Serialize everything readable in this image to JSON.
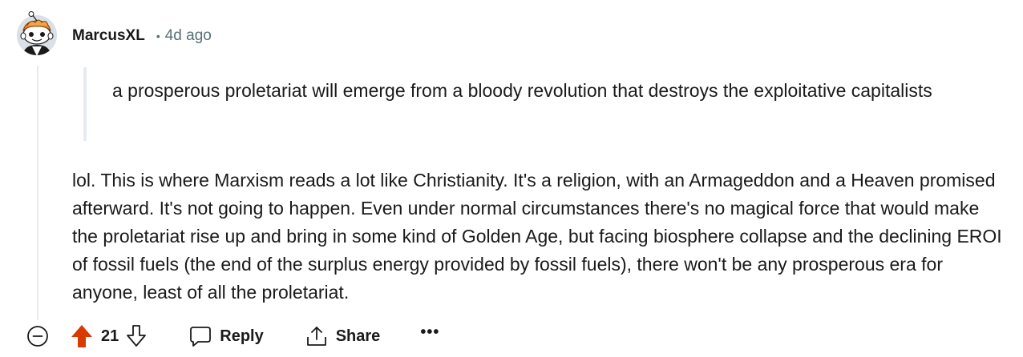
{
  "comment": {
    "author": "MarcusXL",
    "separator": "•",
    "timestamp": "4d ago",
    "quote": "a prosperous proletariat will emerge from a bloody revolution that destroys the exploitative capitalists",
    "body": "lol. This is where Marxism reads a lot like Christianity. It's a religion, with an Armageddon and a Heaven promised afterward. It's not going to happen. Even under normal circumstances there's no magical force that would make the proletariat rise up and bring in some kind of Golden Age, but facing biosphere collapse and the declining EROI of fossil fuels (the end of the surplus energy provided by fossil fuels), there won't be any prosperous era for anyone, least of all the proletariat."
  },
  "actions": {
    "score": "21",
    "reply_label": "Reply",
    "share_label": "Share",
    "more_label": "•••"
  },
  "colors": {
    "upvote_active": "#d93a00",
    "meta_text": "#576f76",
    "thread_line": "#e5ebee"
  },
  "icons": {
    "collapse": "minus-circle-icon",
    "upvote": "upvote-arrow-icon",
    "downvote": "downvote-arrow-icon",
    "reply": "speech-bubble-icon",
    "share": "share-upload-icon",
    "more": "ellipsis-icon"
  }
}
